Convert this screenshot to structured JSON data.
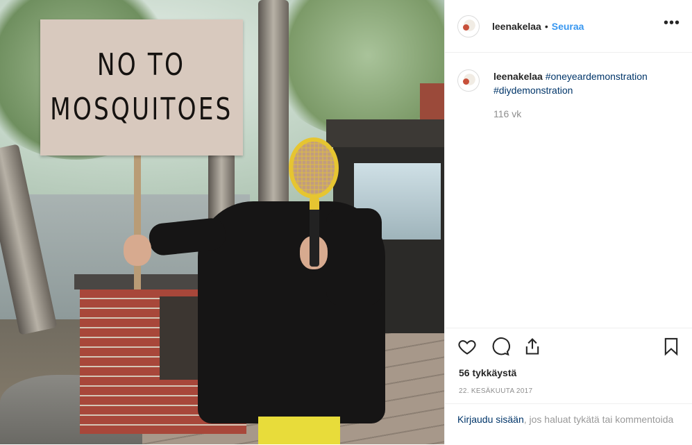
{
  "post": {
    "username": "leenakelaa",
    "separator": "•",
    "follow_label": "Seuraa",
    "more_label": "•••",
    "caption_user": "leenakelaa",
    "hashtags": [
      "#oneyeardemonstration",
      "#diydemonstration"
    ],
    "age": "116 vk",
    "likes": "56 tykkäystä",
    "date": "22. KESÄKUUTA 2017",
    "login_link": "Kirjaudu sisään",
    "login_rest": ", jos haluat tykätä tai kommentoida"
  },
  "photo": {
    "sign_line1": "NO TO",
    "sign_line2": "MOSQUITOES"
  },
  "icons": {
    "like": "heart-icon",
    "comment": "comment-icon",
    "share": "share-icon",
    "save": "bookmark-icon"
  },
  "colors": {
    "link": "#003569",
    "follow": "#3897f0",
    "muted": "#8e8e8e"
  }
}
